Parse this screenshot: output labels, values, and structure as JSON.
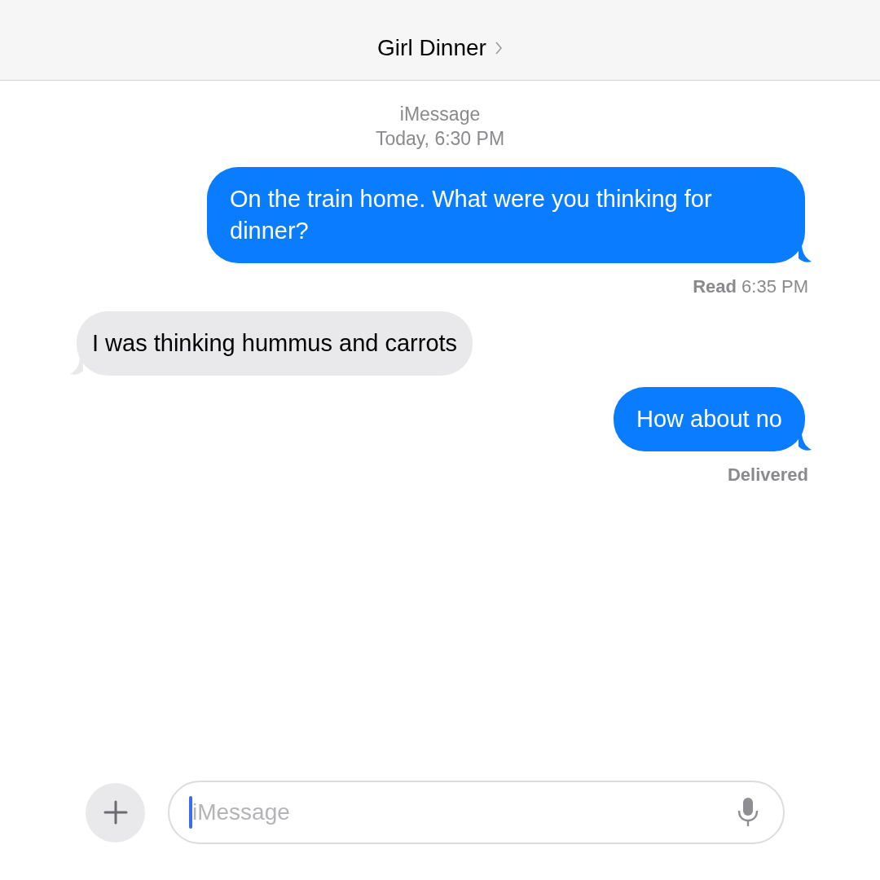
{
  "header": {
    "title": "Girl Dinner"
  },
  "service": "iMessage",
  "timestamp": "Today, 6:30 PM",
  "messages": [
    {
      "kind": "sent",
      "text": "On the train home. What were you thinking for dinner?",
      "receipt": "**Read** 6:35 PM"
    },
    {
      "kind": "received",
      "text": "I was thinking hummus and carrots"
    },
    {
      "kind": "sent",
      "text": "How about no",
      "receipt": "**Delivered**"
    }
  ],
  "composer": {
    "placeholder": "iMessage"
  }
}
